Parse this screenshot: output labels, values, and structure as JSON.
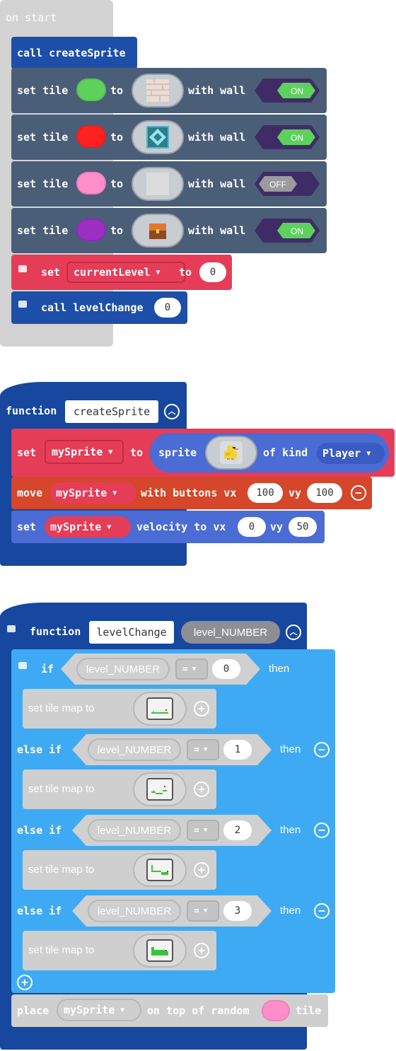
{
  "colors": {
    "events": "#d3d3d3",
    "functions_dark": "#17479e",
    "call": "#1e4fa8",
    "scene": "#4b5e78",
    "variables": "#e53d58",
    "controller": "#d5462a",
    "sprites": "#4a6cd4",
    "logic": "#3eaaf4",
    "disabled": "#cfcfcf"
  },
  "on_start": {
    "hat_label": "on start",
    "call_create": "call createSprite",
    "tile_rows": [
      {
        "set_label": "set tile",
        "to_label": "to",
        "color": "#5ed15d",
        "icon": "brick-wall-tile-icon",
        "with_wall": "with wall",
        "toggle": "ON"
      },
      {
        "set_label": "set tile",
        "to_label": "to",
        "color": "#ff2020",
        "icon": "teal-diamond-tile-icon",
        "with_wall": "with wall",
        "toggle": "ON"
      },
      {
        "set_label": "set tile",
        "to_label": "to",
        "color": "#ff8ecb",
        "icon": "blank-tile-icon",
        "with_wall": "with wall",
        "toggle": "OFF"
      },
      {
        "set_label": "set tile",
        "to_label": "to",
        "color": "#9b2fc4",
        "icon": "treasure-chest-tile-icon",
        "with_wall": "with wall",
        "toggle": "ON"
      }
    ],
    "set_var": {
      "set_label": "set",
      "variable": "currentLevel",
      "to_label": "to",
      "value": "0"
    },
    "call_level": {
      "label": "call levelChange",
      "value": "0"
    }
  },
  "create_sprite": {
    "function_label": "function",
    "name": "createSprite",
    "set_row": {
      "set_label": "set",
      "variable": "mySprite",
      "to_label": "to",
      "sprite_label": "sprite",
      "of_kind": "of kind",
      "kind": "Player"
    },
    "move_row": {
      "move_label": "move",
      "variable": "mySprite",
      "with_buttons": "with buttons vx",
      "vx": "100",
      "vy_label": "vy",
      "vy": "100"
    },
    "velocity_row": {
      "set_label": "set",
      "variable": "mySprite",
      "velocity_label": "velocity to vx",
      "vx": "0",
      "vy_label": "vy",
      "vy": "50"
    }
  },
  "level_change": {
    "function_label": "function",
    "name": "levelChange",
    "param": "level_NUMBER",
    "if_label": "if",
    "else_if_label": "else if",
    "then_label": "then",
    "operator": "=",
    "tilemap_label": "set tile map to",
    "conditions": [
      {
        "variable": "level_NUMBER",
        "value": "0"
      },
      {
        "variable": "level_NUMBER",
        "value": "1"
      },
      {
        "variable": "level_NUMBER",
        "value": "2"
      },
      {
        "variable": "level_NUMBER",
        "value": "3"
      }
    ],
    "place_row": {
      "place_label": "place",
      "variable": "mySprite",
      "on_top": "on top of random",
      "tile_label": "tile",
      "color": "#ff8ecb"
    }
  }
}
